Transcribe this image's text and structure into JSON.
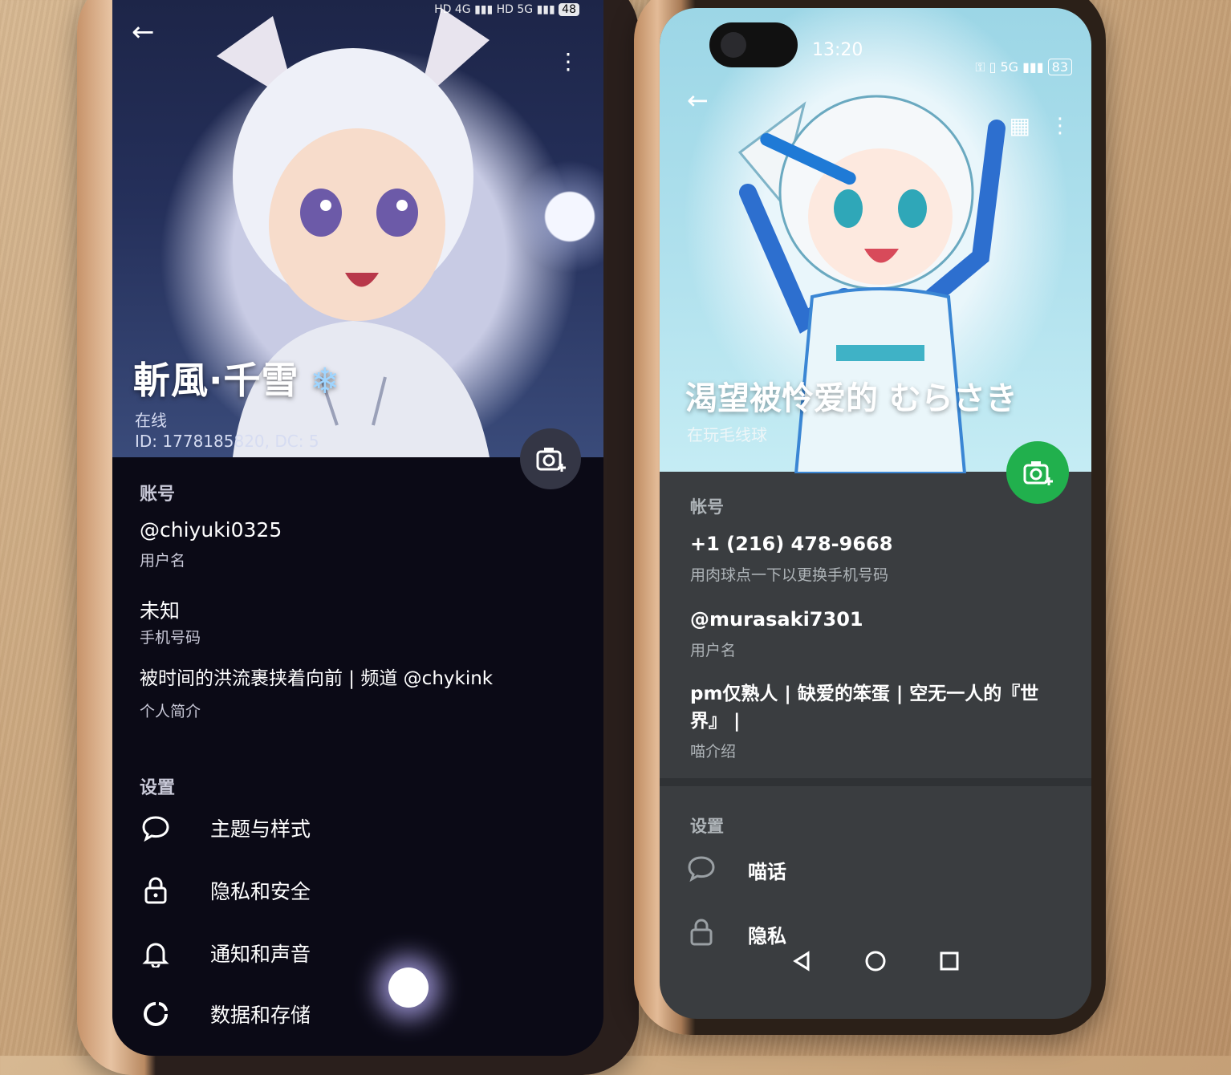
{
  "left_phone": {
    "status_bar": {
      "battery": "48",
      "network": "5G"
    },
    "profile": {
      "display_name": "斬風·千雪",
      "snow_emoji": "❄",
      "status": "在线",
      "id_line": "ID: 1778185820, DC: 5"
    },
    "account": {
      "section_title": "账号",
      "username": "@chiyuki0325",
      "username_caption": "用户名",
      "phone": "未知",
      "phone_caption": "手机号码",
      "bio": "被时间的洪流裹挟着向前 | 频道 @chykink",
      "bio_caption": "个人简介"
    },
    "settings": {
      "section_title": "设置",
      "items": [
        {
          "label": "主题与样式",
          "icon": "chat-bubble-icon"
        },
        {
          "label": "隐私和安全",
          "icon": "lock-icon"
        },
        {
          "label": "通知和声音",
          "icon": "bell-icon"
        },
        {
          "label": "数据和存储",
          "icon": "data-pie-icon"
        }
      ]
    }
  },
  "right_phone": {
    "status_bar": {
      "time": "13:20",
      "battery": "83",
      "network": "5G"
    },
    "profile": {
      "display_name": "渴望被怜爱的 むらさき",
      "status": "在玩毛线球"
    },
    "account": {
      "section_title": "帐号",
      "phone": "+1 (216) 478-9668",
      "phone_caption": "用肉球点一下以更换手机号码",
      "username": "@murasaki7301",
      "username_caption": "用户名",
      "bio": "pm仅熟人 | 缺爱的笨蛋 | 空无一人的『世界』 |",
      "bio_caption": "喵介绍"
    },
    "settings": {
      "section_title": "设置",
      "items": [
        {
          "label": "喵话",
          "icon": "chat-bubble-icon"
        },
        {
          "label": "隐私",
          "icon": "lock-icon"
        }
      ]
    }
  },
  "colors": {
    "camera_green": "#21b04d",
    "dark_bg": "#0b0a16",
    "right_bg": "#3a3d40"
  }
}
